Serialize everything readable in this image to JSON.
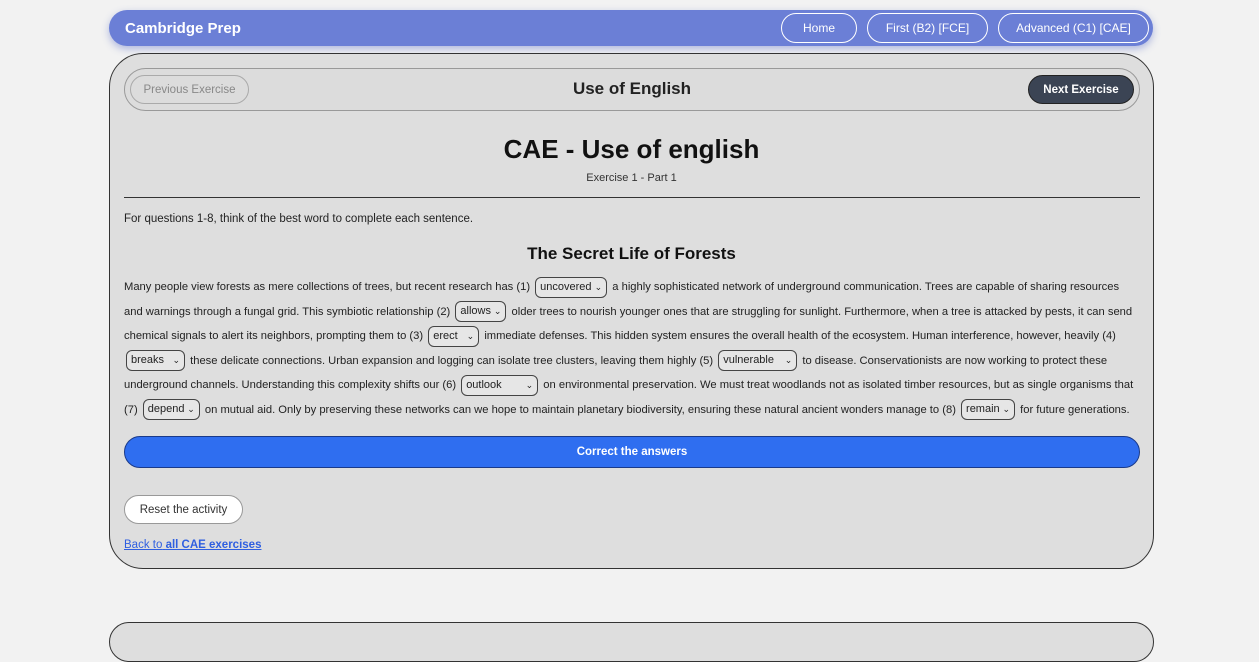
{
  "navbar": {
    "brand": "Cambridge Prep",
    "links": [
      "Home",
      "First (B2) [FCE]",
      "Advanced (C1) [CAE]"
    ]
  },
  "exercise_header": {
    "prev_label": "Previous Exercise",
    "title": "Use of English",
    "next_label": "Next Exercise"
  },
  "main": {
    "title": "CAE - Use of english",
    "subtitle": "Exercise 1 - Part 1",
    "instructions": "For questions 1-8, think of the best word to complete each sentence.",
    "text_title": "The Secret Life of Forests"
  },
  "passage": {
    "p0": "Many people view forests as mere collections of trees, but recent research has (1)",
    "g1": "uncovered",
    "p1": "a highly sophisticated network of underground communication. Trees are capable of sharing resources and warnings through a fungal grid. This symbiotic relationship (2)",
    "g2": "allows",
    "p2": "older trees to nourish younger ones that are struggling for sunlight. Furthermore, when a tree is attacked by pests, it can send chemical signals to alert its neighbors, prompting them to (3)",
    "g3": "erect",
    "p3": "immediate defenses. This hidden system ensures the overall health of the ecosystem. Human interference, however, heavily (4)",
    "g4": "breaks",
    "p4": "these delicate connections. Urban expansion and logging can isolate tree clusters, leaving them highly (5)",
    "g5": "vulnerable",
    "p5": "to disease. Conservationists are now working to protect these underground channels. Understanding this complexity shifts our (6)",
    "g6": "outlook",
    "p6": "on environmental preservation. We must treat woodlands not as isolated timber resources, but as single organisms that (7)",
    "g7": "depend",
    "p7": "on mutual aid. Only by preserving these networks can we hope to maintain planetary biodiversity, ensuring these natural ancient wonders manage to (8)",
    "g8": "remain",
    "p8": "for future generations."
  },
  "actions": {
    "correct_label": "Correct the answers",
    "reset_label": "Reset the activity",
    "back_prefix": "Back to",
    "back_link": "all CAE exercises"
  },
  "colors": {
    "navbar": "#6b7fd6",
    "primary_button": "#2f6ef0",
    "next_button": "#3b4454",
    "card_background": "#dedede"
  },
  "icons": {
    "select_arrow": "chevron-down-icon"
  }
}
